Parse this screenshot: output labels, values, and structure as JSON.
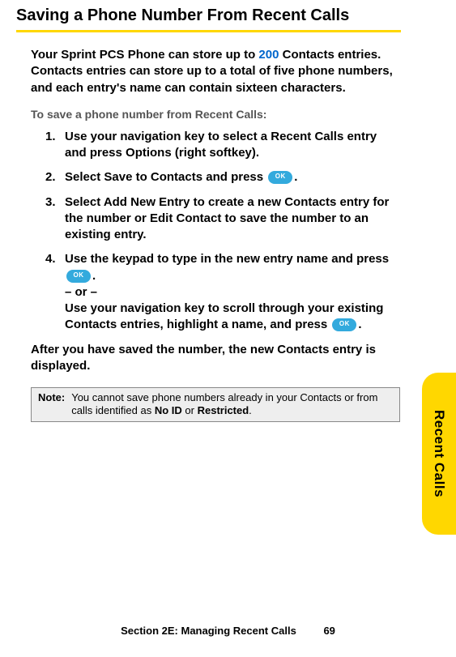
{
  "title": "Saving a Phone Number From Recent Calls",
  "intro_pre": "Your Sprint PCS Phone can store up to ",
  "intro_num": "200",
  "intro_post": " Contacts entries. Contacts entries can store up to a total of five phone numbers, and each entry's name can contain sixteen characters.",
  "subhead": "To save a phone number from Recent Calls:",
  "steps": {
    "s1": {
      "num": "1.",
      "text_a": "Use your navigation key to select a Recent Calls entry and press ",
      "term_a": "Options",
      "text_b": " (right softkey)."
    },
    "s2": {
      "num": "2.",
      "text_a": "Select ",
      "term_a": "Save to Contacts",
      "text_b": " and press ",
      "ok": "OK",
      "text_c": "."
    },
    "s3": {
      "num": "3.",
      "text_a": "Select ",
      "term_a": "Add New Entry",
      "text_b": " to create a new Contacts entry for the number or ",
      "term_b": "Edit Contact",
      "text_c": " to save the number to an existing entry."
    },
    "s4": {
      "num": "4.",
      "text_a": "Use the keypad to type in the new entry name and press ",
      "ok1": "OK",
      "text_b": ".",
      "or": "– or –",
      "text_c": "Use your navigation key to scroll through your existing Contacts entries, highlight a name, and press ",
      "ok2": "OK",
      "text_d": "."
    }
  },
  "after": "After you have saved the number, the new Contacts entry is displayed.",
  "note": {
    "label": "Note:",
    "text_a": "You cannot save phone numbers already in your Contacts or from calls identified as ",
    "term_a": "No ID",
    "text_b": " or ",
    "term_b": "Restricted",
    "text_c": "."
  },
  "side_tab": "Recent Calls",
  "footer": {
    "section": "Section 2E: Managing Recent Calls",
    "page": "69"
  }
}
